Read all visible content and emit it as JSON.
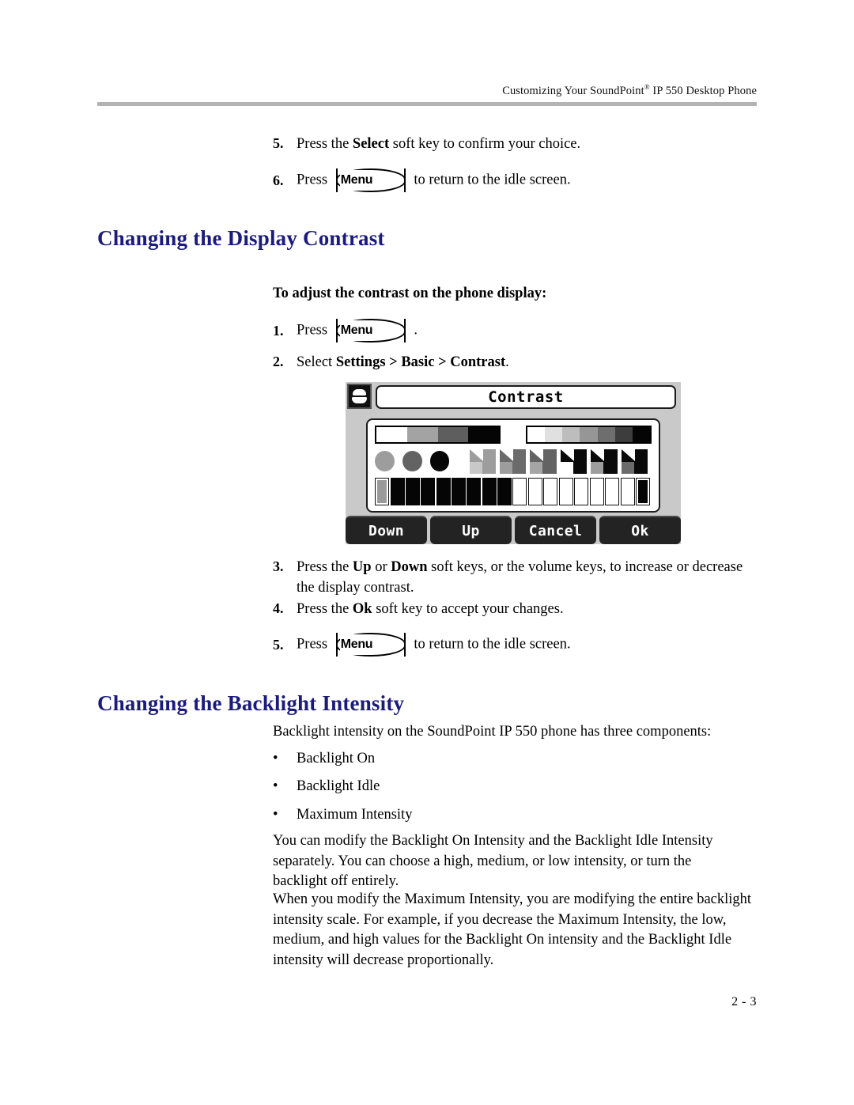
{
  "header": {
    "text_before": "Customizing Your SoundPoint",
    "registered_mark": "®",
    "text_after": " IP 550 Desktop Phone"
  },
  "top_steps": [
    {
      "num": "5.",
      "text_before": "Press the ",
      "bold": "Select",
      "text_after": " soft key to confirm your choice."
    },
    {
      "num": "6.",
      "text_before": "Press",
      "key": "Menu",
      "text_after": "to return to the idle screen."
    }
  ],
  "section_contrast": {
    "heading": "Changing the Display Contrast",
    "subheading": "To adjust the contrast on the phone display:",
    "step1": {
      "num": "1.",
      "text_before": "Press",
      "key": "Menu",
      "text_after": "."
    },
    "step2": {
      "num": "2.",
      "text_before": "Select ",
      "bold": "Settings > Basic > Contrast",
      "text_after": "."
    },
    "step3": {
      "num": "3.",
      "p1": "Press the ",
      "b1": "Up",
      "p2": " or ",
      "b2": "Down",
      "p3": " soft keys, or the volume keys, to increase or decrease the display contrast."
    },
    "step4": {
      "num": "4.",
      "text_before": "Press the ",
      "bold": "Ok",
      "text_after": " soft key to accept your changes."
    },
    "step5": {
      "num": "5.",
      "text_before": "Press",
      "key": "Menu",
      "text_after": "to return to the idle screen."
    }
  },
  "lcd": {
    "status_icon": "phone-handset-icon",
    "title": "Contrast",
    "softkeys": [
      "Down",
      "Up",
      "Cancel",
      "Ok"
    ],
    "grayscale_ramp": [
      "#ffffff",
      "#a3a3a3",
      "#5e5e5e",
      "#050505"
    ],
    "dither_ramp": [
      "#ffffff",
      "#e0e0e0",
      "#bdbdbd",
      "#969696",
      "#6e6e6e",
      "#3d3d3d",
      "#050505"
    ],
    "circles": [
      "#9d9d9d",
      "#636363",
      "#060606"
    ],
    "corner_shapes": [
      {
        "bg": "#9d9d9d",
        "notch": "#c8c8c8"
      },
      {
        "bg": "#6b6b6b",
        "notch": "#9d9d9d"
      },
      {
        "bg": "#636363",
        "notch": "#a5a5a5"
      },
      {
        "bg": "#0a0a0a",
        "notch": "#ffffff"
      },
      {
        "bg": "#0a0a0a",
        "notch": "#9d9d9d"
      },
      {
        "bg": "#0a0a0a",
        "notch": "#6b6b6b"
      }
    ],
    "level_bars": {
      "first_fill": "#9a9a9a",
      "solid_count": 8,
      "empty_count": 8,
      "last_fill": "#050505"
    }
  },
  "section_backlight": {
    "heading": "Changing the Backlight Intensity",
    "intro": "Backlight intensity on the SoundPoint IP 550 phone has three components:",
    "bullets": [
      "Backlight On",
      "Backlight Idle",
      "Maximum Intensity"
    ],
    "para1": "You can modify the Backlight On Intensity and the Backlight Idle Intensity separately. You can choose a high, medium, or low intensity, or turn the backlight off entirely.",
    "para2": "When you modify the Maximum Intensity, you are modifying the entire backlight intensity scale. For example, if you decrease the Maximum Intensity, the low, medium, and high values for the Backlight On intensity and the Backlight Idle intensity will decrease proportionally."
  },
  "footer": {
    "page_number": "2 - 3"
  },
  "bullet_char": "•"
}
